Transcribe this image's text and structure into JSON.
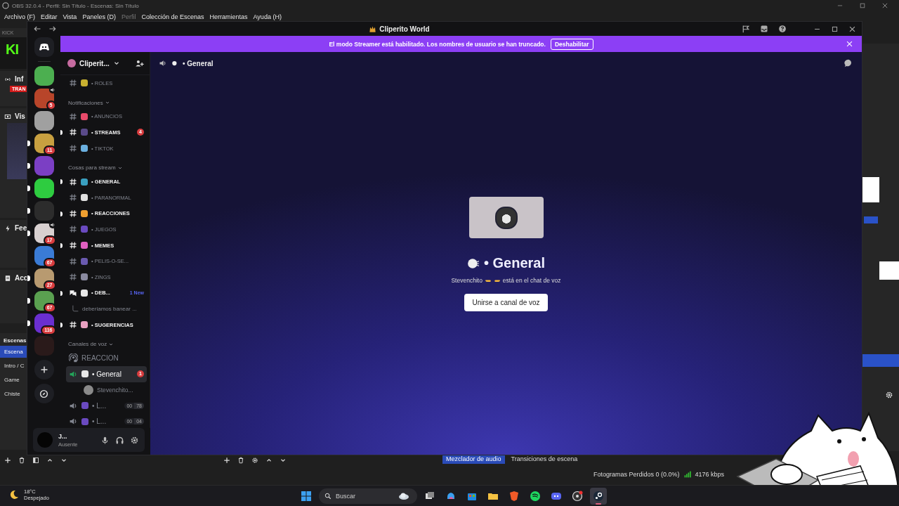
{
  "obs": {
    "title": "OBS 32.0.4 - Perfil: Sin Título - Escenas: Sin Título",
    "menu": [
      {
        "label": "Archivo (F)",
        "disabled": false
      },
      {
        "label": "Editar",
        "disabled": false
      },
      {
        "label": "Vista",
        "disabled": false
      },
      {
        "label": "Paneles (D)",
        "disabled": false
      },
      {
        "label": "Perfil",
        "disabled": true
      },
      {
        "label": "Colección de Escenas",
        "disabled": false
      },
      {
        "label": "Herramientas",
        "disabled": false
      },
      {
        "label": "Ayuda (H)",
        "disabled": false
      }
    ],
    "kick": {
      "title": "KICK",
      "logo": "KI"
    },
    "docks": [
      {
        "title": "Inf",
        "tag": "TRAN"
      },
      {
        "title": "Vis"
      },
      {
        "title": "Fee"
      },
      {
        "title": "Acc"
      }
    ],
    "scenes": {
      "title": "Escenas",
      "items": [
        {
          "label": "Escena",
          "selected": true
        },
        {
          "label": "Intro / C",
          "selected": false
        },
        {
          "label": "Game",
          "selected": false
        },
        {
          "label": "Chiste",
          "selected": false
        }
      ]
    },
    "mixer_tabs": [
      {
        "label": "Mezclador de audio",
        "selected": true
      },
      {
        "label": "Transiciones de escena",
        "selected": false
      }
    ],
    "status": {
      "dropped": "Fotogramas Perdidos 0 (0.0%)",
      "bitrate": "4176 kbps"
    }
  },
  "discord": {
    "title": "Cliperito World",
    "banner": {
      "message": "El modo Streamer está habilitado. Los nombres de usuario se han truncado.",
      "button": "Deshabilitar"
    },
    "servers": [
      {
        "color": "#4caf50",
        "unread": false,
        "speaker": false
      },
      {
        "color": "#b8452a",
        "unread": false,
        "speaker": true,
        "badge": "5"
      },
      {
        "color": "#a0a0a0",
        "unread": false,
        "speaker": false
      },
      {
        "color": "#c8a040",
        "unread": true,
        "speaker": false,
        "badge": "11"
      },
      {
        "color": "#7b3fc4",
        "unread": true,
        "speaker": false
      },
      {
        "color": "#2ecc40",
        "unread": true,
        "speaker": false
      },
      {
        "color": "#2c2c2c",
        "unread": true,
        "speaker": false
      },
      {
        "color": "#d8d0d0",
        "unread": true,
        "speaker": true,
        "badge": "17"
      },
      {
        "color": "#3a7bd5",
        "unread": false,
        "speaker": false,
        "badge": "67"
      },
      {
        "color": "#b89a70",
        "unread": true,
        "speaker": false,
        "badge": "27"
      },
      {
        "color": "#5aa050",
        "unread": true,
        "speaker": false,
        "badge": "67"
      },
      {
        "color": "#6a2fd0",
        "unread": true,
        "speaker": false,
        "badge": "116"
      },
      {
        "color": "#2a1a1a",
        "unread": false,
        "speaker": false
      }
    ],
    "server_name": "Cliperit...",
    "channels": [
      {
        "kind": "text",
        "name": "• ROLES",
        "color": "#c8b030",
        "unread": false,
        "selected": false
      },
      {
        "kind": "category",
        "name": "Notificaciones"
      },
      {
        "kind": "text",
        "name": "• ANUNCIOS",
        "color": "#e84a6a",
        "unread": false,
        "selected": false
      },
      {
        "kind": "text",
        "name": "• STREAMS",
        "color": "#5a4a8a",
        "unread": true,
        "selected": false,
        "badge": "4"
      },
      {
        "kind": "text",
        "name": "• TIKTOK",
        "color": "#6bb0e0",
        "unread": false,
        "selected": false
      },
      {
        "kind": "category",
        "name": "Cosas para stream"
      },
      {
        "kind": "text",
        "name": "• GENERAL",
        "color": "#3aa0c0",
        "unread": true,
        "selected": false
      },
      {
        "kind": "text",
        "name": "• PARANORMAL",
        "color": "#e0e0e0",
        "unread": false,
        "selected": false
      },
      {
        "kind": "text",
        "name": "• REACCIONES",
        "color": "#f0a030",
        "unread": true,
        "selected": false
      },
      {
        "kind": "text",
        "name": "• JUEGOS",
        "color": "#6a4ac0",
        "unread": false,
        "selected": false
      },
      {
        "kind": "text",
        "name": "• MEMES",
        "color": "#e060c0",
        "unread": true,
        "selected": false
      },
      {
        "kind": "text",
        "name": "• PELIS-O-SE...",
        "color": "#6a5ab0",
        "unread": false,
        "selected": false
      },
      {
        "kind": "text",
        "name": "• ZINGS",
        "color": "#8a8aa0",
        "unread": false,
        "selected": false
      },
      {
        "kind": "forum",
        "name": "• DEB...",
        "color": "#e8e8e8",
        "unread": true,
        "selected": false,
        "tag": "1 New"
      },
      {
        "kind": "thread",
        "name": "deberiamos banear ...",
        "selected": false
      },
      {
        "kind": "text",
        "name": "• SUGERENCIAS",
        "color": "#e8a0c0",
        "unread": true,
        "selected": false
      },
      {
        "kind": "category",
        "name": "Canales de voz"
      },
      {
        "kind": "stage",
        "name": "REACCION",
        "selected": false
      },
      {
        "kind": "voice",
        "name": "• General",
        "color": "#e8e8e8",
        "speaking": true,
        "selected": true,
        "badge": "1"
      },
      {
        "kind": "voice_user",
        "name": "Stevenchito...",
        "selected": false
      },
      {
        "kind": "voice",
        "name": "• L...",
        "color": "#6a4ac0",
        "speaking": false,
        "selected": false,
        "count": "00",
        "limit": "78"
      },
      {
        "kind": "voice",
        "name": "• L...",
        "color": "#6a4ac0",
        "speaking": false,
        "selected": false,
        "count": "00",
        "limit": "04"
      }
    ],
    "user": {
      "name": "J...",
      "status": "Ausente"
    },
    "header": {
      "channel": "• General"
    },
    "voice": {
      "title": "• General",
      "occupant": "Stevenchito",
      "activity": "está en el chat de voz",
      "join": "Unirse a canal de voz"
    }
  },
  "taskbar": {
    "temp": "18°C",
    "weather": "Despejado",
    "search": "Buscar",
    "apps": [
      {
        "kind": "taskview",
        "active": false
      },
      {
        "kind": "copilot",
        "active": false
      },
      {
        "kind": "store",
        "active": false
      },
      {
        "kind": "folder",
        "active": false
      },
      {
        "kind": "shield",
        "active": false
      },
      {
        "kind": "music",
        "active": false
      },
      {
        "kind": "chat",
        "active": false
      },
      {
        "kind": "recorder",
        "active": false
      },
      {
        "kind": "steam",
        "active": true
      }
    ]
  }
}
